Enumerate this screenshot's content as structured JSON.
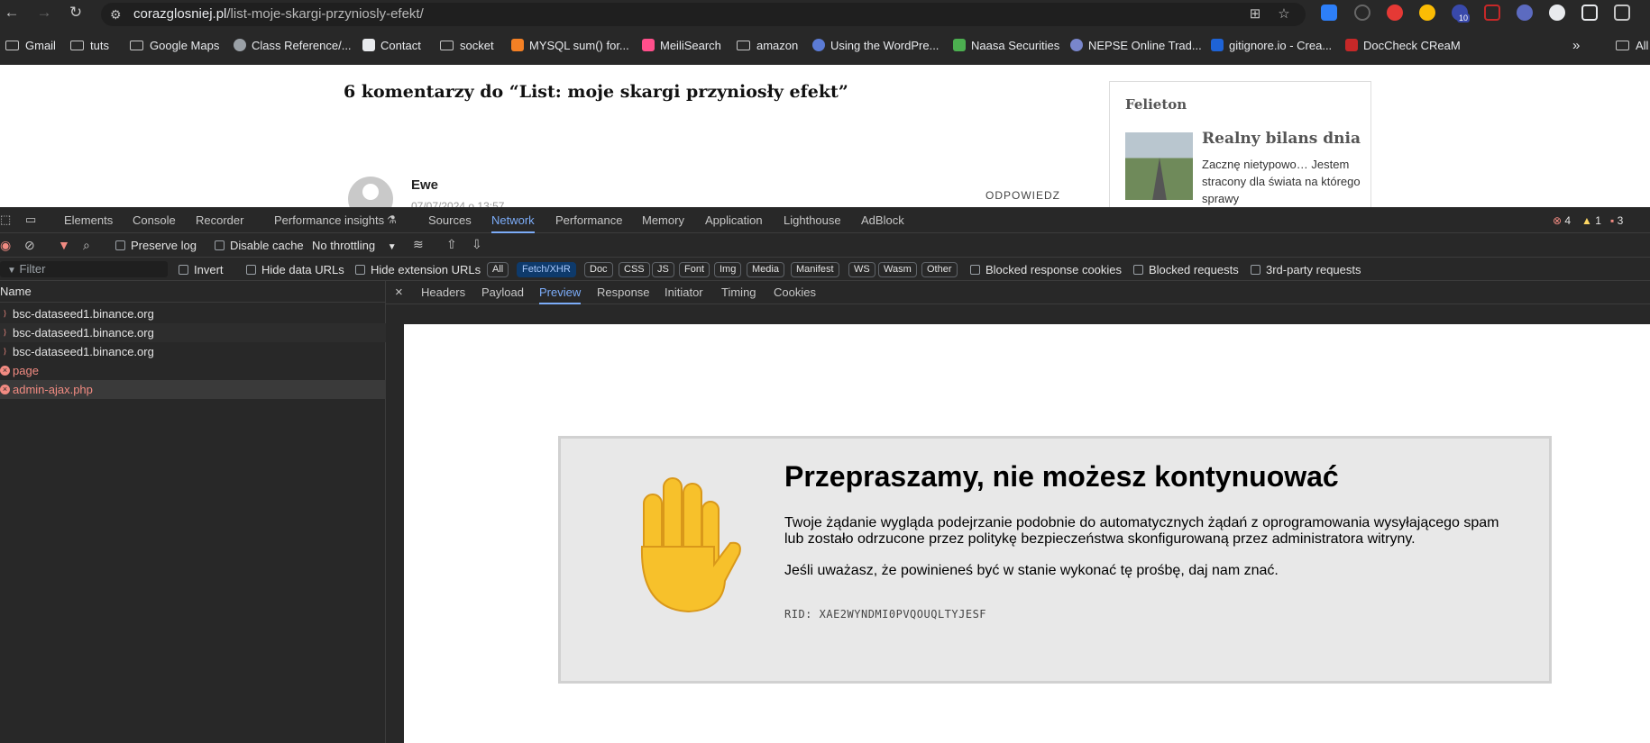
{
  "browser": {
    "url_domain": "corazglosniej.pl",
    "url_path": "/list-moje-skargi-przyniosly-efekt/"
  },
  "bookmarks": [
    "Gmail",
    "tuts",
    "Google Maps",
    "Class Reference/...",
    "Contact",
    "socket",
    "MYSQL sum() for...",
    "MeiliSearch",
    "amazon",
    "Using the WordPre...",
    "Naasa Securities",
    "NEPSE Online Trad...",
    "gitignore.io - Crea...",
    "DocCheck CReaM",
    "All"
  ],
  "ext_badge": "10",
  "page": {
    "comments_heading": "6 komentarzy do “List: moje skargi przyniosły efekt”",
    "commenter": "Ewe",
    "comment_date": "07/07/2024 o 13:57",
    "reply": "ODPOWIEDZ",
    "widget_title": "Felieton",
    "article_title": "Realny bilans dnia",
    "article_excerpt": "Zacznę nietypowo… Jestem stracony dla świata na którego sprawy"
  },
  "devtools": {
    "tabs": [
      "Elements",
      "Console",
      "Recorder",
      "Performance insights",
      "Sources",
      "Network",
      "Performance",
      "Memory",
      "Application",
      "Lighthouse",
      "AdBlock"
    ],
    "errors": "4",
    "warnings": "1",
    "issues": "3",
    "preserve_log": "Preserve log",
    "disable_cache": "Disable cache",
    "throttling": "No throttling",
    "filter_placeholder": "Filter",
    "invert": "Invert",
    "hide_data_urls": "Hide data URLs",
    "hide_ext_urls": "Hide extension URLs",
    "types": [
      "All",
      "Fetch/XHR",
      "Doc",
      "CSS",
      "JS",
      "Font",
      "Img",
      "Media",
      "Manifest",
      "WS",
      "Wasm",
      "Other"
    ],
    "blocked_cookies": "Blocked response cookies",
    "blocked_requests": "Blocked requests",
    "third_party": "3rd-party requests",
    "name_header": "Name",
    "requests": [
      {
        "name": "bsc-dataseed1.binance.org",
        "status": "pending"
      },
      {
        "name": "bsc-dataseed1.binance.org",
        "status": "pending"
      },
      {
        "name": "bsc-dataseed1.binance.org",
        "status": "pending"
      },
      {
        "name": "page",
        "status": "error"
      },
      {
        "name": "admin-ajax.php",
        "status": "error"
      }
    ],
    "detail_tabs": [
      "Headers",
      "Payload",
      "Preview",
      "Response",
      "Initiator",
      "Timing",
      "Cookies"
    ],
    "active_detail": "Preview"
  },
  "block_page": {
    "title": "Przepraszamy, nie możesz kontynuować",
    "p1": "Twoje żądanie wygląda podejrzanie podobnie do automatycznych żądań z oprogramowania wysyłającego spam lub zostało odrzucone przez politykę bezpieczeństwa skonfigurowaną przez administratora witryny.",
    "p2": "Jeśli uważasz, że powinieneś być w stanie wykonać tę prośbę, daj nam znać.",
    "rid": "RID: XAE2WYNDMI0PVQOUQLTYJESF"
  },
  "colors": {
    "accent": "#7cacf8",
    "error": "#f28b82",
    "hand": "#f7c12b"
  }
}
